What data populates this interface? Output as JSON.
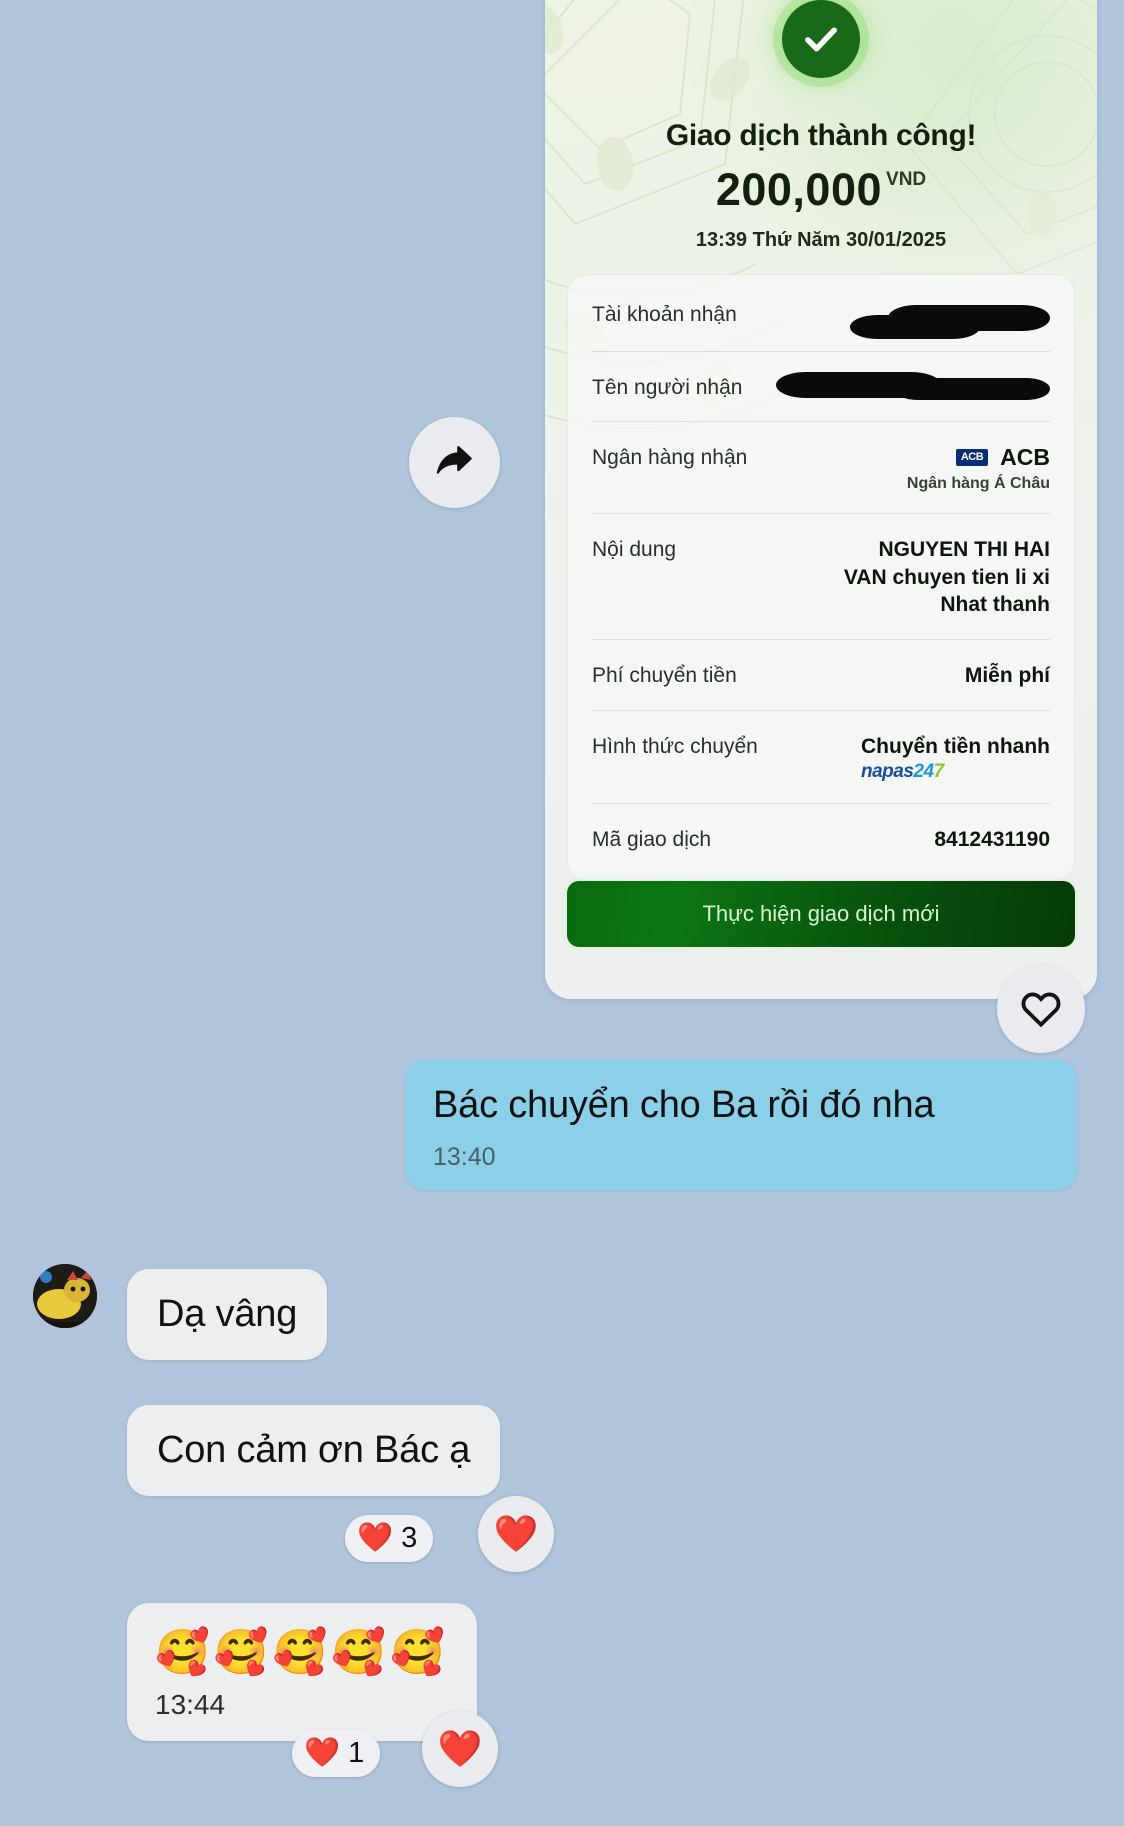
{
  "background_color": "#b0c5db",
  "receipt": {
    "status_icon": "check-circle-icon",
    "title": "Giao dịch thành công!",
    "amount": "200,000",
    "currency": "VND",
    "datetime": "13:39 Thứ Năm 30/01/2025",
    "rows": [
      {
        "label": "Tài khoản nhận",
        "value": "",
        "redacted": true
      },
      {
        "label": "Tên người nhận",
        "value": "",
        "redacted": true
      },
      {
        "label": "Ngân hàng nhận",
        "value": "ACB",
        "logo_text": "ACB",
        "sub": "Ngân hàng Á Châu"
      },
      {
        "label": "Nội dung",
        "value": "NGUYEN THI HAI VAN chuyen tien li xi Nhat thanh"
      },
      {
        "label": "Phí chuyển tiền",
        "value": "Miễn phí"
      },
      {
        "label": "Hình thức chuyển",
        "value": "Chuyển tiền nhanh",
        "sub_logo": "napas 247"
      },
      {
        "label": "Mã giao dịch",
        "value": "8412431190"
      }
    ],
    "content_lines": [
      "NGUYEN THI HAI",
      "VAN chuyen tien li xi",
      "Nhat thanh"
    ],
    "napas_logo": {
      "part1": "napas",
      "part2": "24",
      "part3": "7"
    },
    "new_transaction_button": "Thực hiện giao dịch mới",
    "brand_green": "#0a6b0f",
    "acb_blue": "#0b2d72"
  },
  "actions": {
    "forward_icon": "forward-arrow-icon",
    "favorite_icon": "heart-outline-icon"
  },
  "messages": [
    {
      "id": "msg-out-1",
      "direction": "outgoing",
      "text": "Bác chuyển cho Ba rồi đó nha",
      "time": "13:40"
    },
    {
      "id": "msg-in-1",
      "direction": "incoming",
      "text": "Dạ vâng",
      "time": ""
    },
    {
      "id": "msg-in-2",
      "direction": "incoming",
      "text": "Con cảm ơn Bác ạ",
      "time": "",
      "reaction": {
        "emoji": "❤️",
        "count": "3"
      }
    },
    {
      "id": "msg-in-3",
      "direction": "incoming",
      "text": "🥰🥰🥰🥰🥰",
      "time": "13:44",
      "reaction": {
        "emoji": "❤️",
        "count": "1"
      }
    }
  ],
  "reaction_buttons": {
    "heart_emoji": "❤️"
  }
}
